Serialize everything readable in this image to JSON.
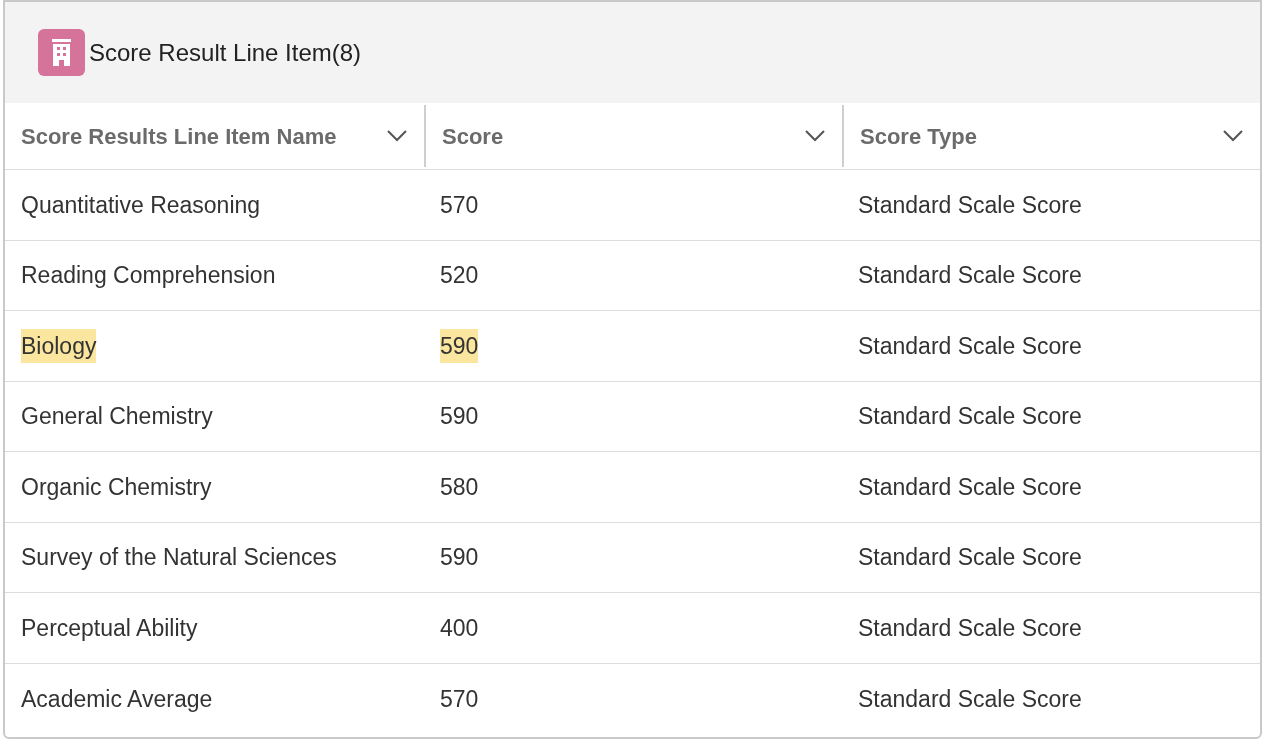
{
  "card": {
    "title": "Score Result Line Item(8)"
  },
  "table": {
    "columns": [
      "Score Results Line Item Name",
      "Score",
      "Score Type"
    ],
    "rows": [
      [
        {
          "text": "Quantitative Reasoning",
          "highlighted": false
        },
        {
          "text": "570",
          "highlighted": false
        },
        {
          "text": "Standard Scale Score",
          "highlighted": false
        }
      ],
      [
        {
          "text": "Reading Comprehension",
          "highlighted": false
        },
        {
          "text": "520",
          "highlighted": false
        },
        {
          "text": "Standard Scale Score",
          "highlighted": false
        }
      ],
      [
        {
          "text": "Biology",
          "highlighted": true
        },
        {
          "text": "590",
          "highlighted": true
        },
        {
          "text": "Standard Scale Score",
          "highlighted": false
        }
      ],
      [
        {
          "text": "General Chemistry",
          "highlighted": false
        },
        {
          "text": "590",
          "highlighted": false
        },
        {
          "text": "Standard Scale Score",
          "highlighted": false
        }
      ],
      [
        {
          "text": "Organic Chemistry",
          "highlighted": false
        },
        {
          "text": "580",
          "highlighted": false
        },
        {
          "text": "Standard Scale Score",
          "highlighted": false
        }
      ],
      [
        {
          "text": "Survey of the Natural Sciences",
          "highlighted": false
        },
        {
          "text": "590",
          "highlighted": false
        },
        {
          "text": "Standard Scale Score",
          "highlighted": false
        }
      ],
      [
        {
          "text": "Perceptual Ability",
          "highlighted": false
        },
        {
          "text": "400",
          "highlighted": false
        },
        {
          "text": "Standard Scale Score",
          "highlighted": false
        }
      ],
      [
        {
          "text": "Academic Average",
          "highlighted": false
        },
        {
          "text": "570",
          "highlighted": false
        },
        {
          "text": "Standard Scale Score",
          "highlighted": false
        }
      ]
    ]
  }
}
